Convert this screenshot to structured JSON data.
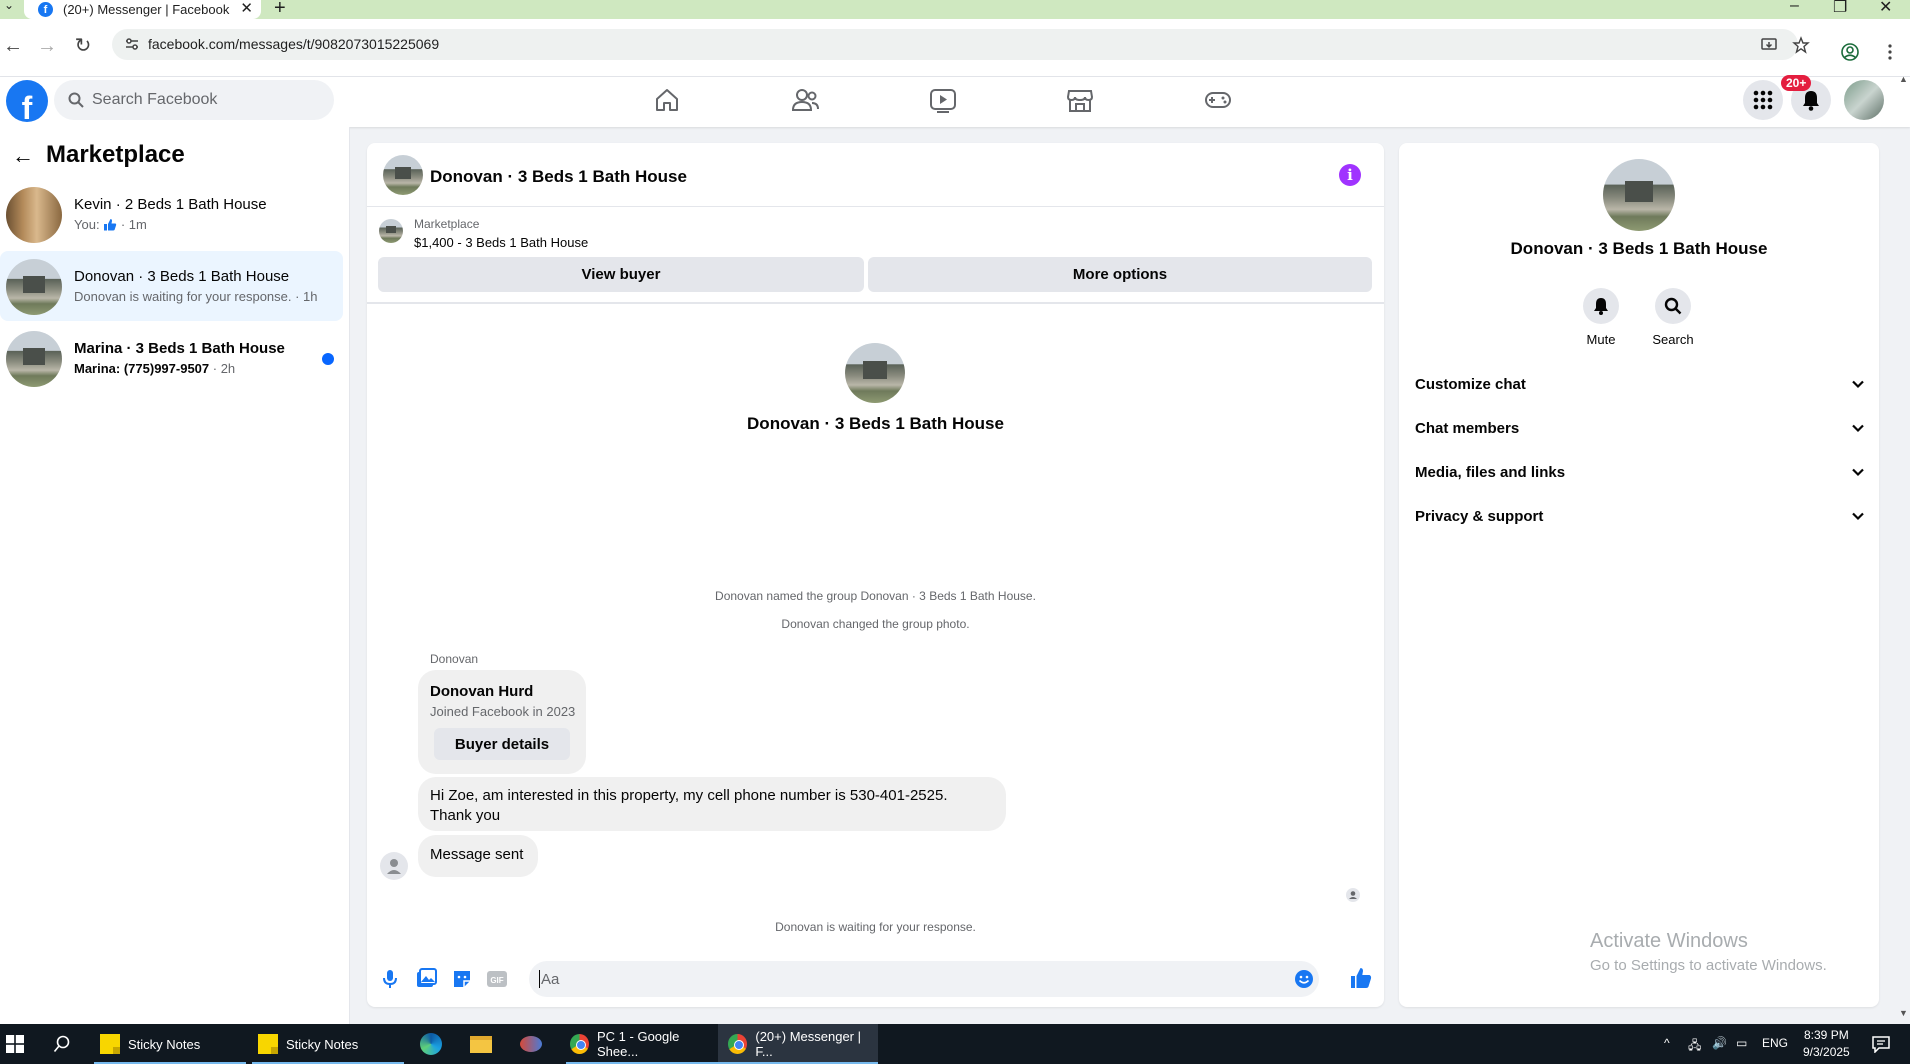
{
  "browser": {
    "tab_title": "(20+) Messenger | Facebook",
    "tab_close": "✕",
    "new_tab": "+",
    "url": "facebook.com/messages/t/9082073015225069"
  },
  "fb_header": {
    "search_placeholder": "Search Facebook",
    "notification_badge": "20+",
    "logo_letter": "f"
  },
  "sidebar": {
    "title": "Marketplace",
    "conversations": [
      {
        "name": "Kevin · 2 Beds 1 Bath House",
        "subtitle_prefix": "You:",
        "subtitle_suffix": " · 1m",
        "unread": false,
        "active": false
      },
      {
        "name": "Donovan · 3 Beds 1 Bath House",
        "subtitle": "Donovan is waiting for your response. · 1h",
        "unread": false,
        "active": true
      },
      {
        "name": "Marina · 3 Beds 1 Bath House",
        "subtitle": "Marina: (775)997-9507",
        "time": " · 2h",
        "unread": true,
        "active": false
      }
    ]
  },
  "chat": {
    "title": "Donovan · 3 Beds 1 Bath House",
    "marketplace_label": "Marketplace",
    "listing": "$1,400 - 3 Beds 1 Bath House",
    "view_buyer": "View buyer",
    "more_options": "More options",
    "center_name": "Donovan · 3 Beds 1 Bath House",
    "sys_named": "Donovan named the group Donovan · 3 Beds 1 Bath House.",
    "sys_photo": "Donovan changed the group photo.",
    "sender": "Donovan",
    "card_name": "Donovan Hurd",
    "card_joined": "Joined Facebook in 2023",
    "buyer_details": "Buyer details",
    "message_line1": "Hi Zoe,  am interested in this property, my cell phone number is 530-401-2525.",
    "message_line2": "Thank you",
    "message_sent": "Message sent",
    "waiting": "Donovan is waiting for your response.",
    "composer_placeholder": "Aa"
  },
  "info_panel": {
    "name": "Donovan · 3 Beds 1 Bath House",
    "mute": "Mute",
    "search": "Search",
    "sections": [
      "Customize chat",
      "Chat members",
      "Media, files and links",
      "Privacy & support"
    ]
  },
  "watermark": {
    "line1": "Activate Windows",
    "line2": "Go to Settings to activate Windows."
  },
  "taskbar": {
    "items": [
      "Sticky Notes",
      "Sticky Notes",
      "PC 1 - Google Shee...",
      "(20+) Messenger | F..."
    ],
    "lang": "ENG",
    "time": "8:39 PM",
    "date": "9/3/2025"
  },
  "colors": {
    "brand": "#1877f2",
    "accent_purple": "#a033ff",
    "unread_dot": "#0866ff",
    "active_row": "#ebf5ff"
  }
}
